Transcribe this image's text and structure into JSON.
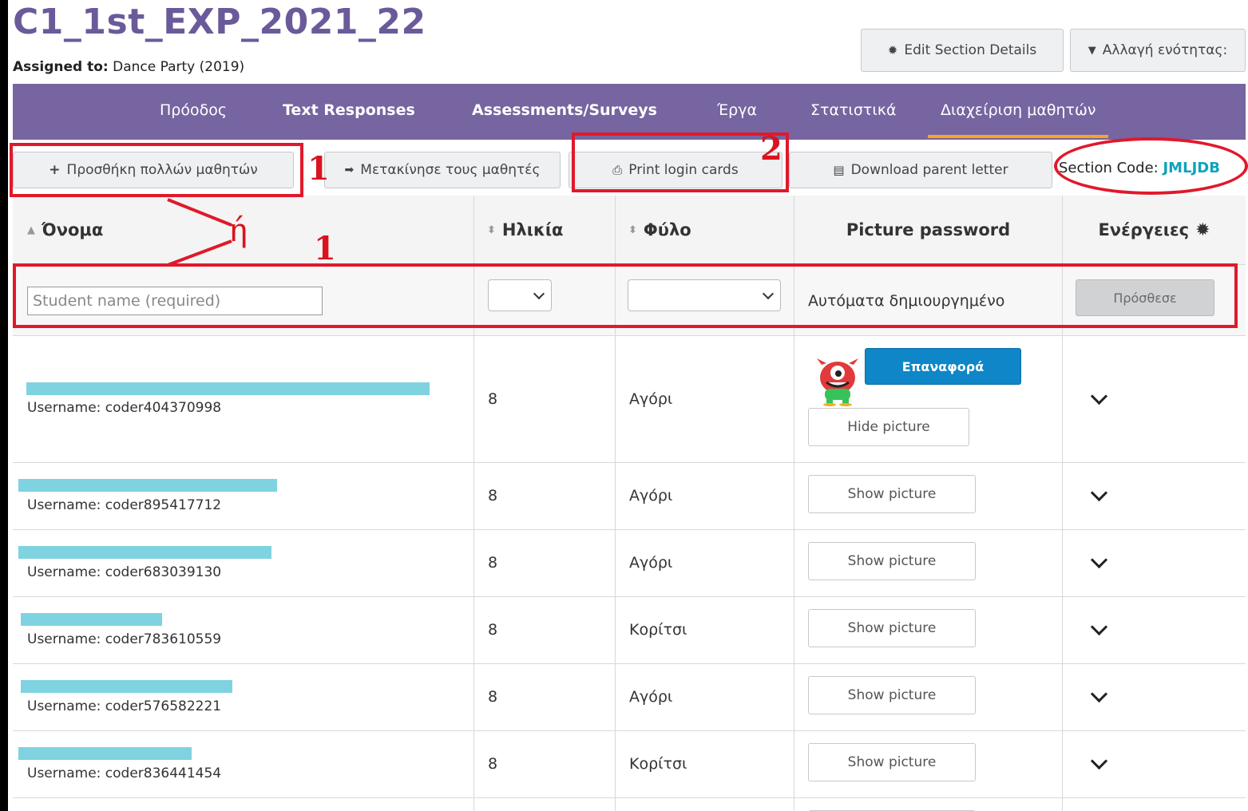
{
  "header": {
    "section_title": "C1_1st_EXP_2021_22",
    "assigned_label": "Assigned to:",
    "assigned_value": "Dance Party (2019)",
    "edit_section_label": "Edit Section Details",
    "change_section_label": "Αλλαγή ενότητας:"
  },
  "nav": {
    "tabs": [
      {
        "label": "Πρόοδος"
      },
      {
        "label": "Text Responses"
      },
      {
        "label": "Assessments/Surveys"
      },
      {
        "label": "Έργα"
      },
      {
        "label": "Στατιστικά"
      },
      {
        "label": "Διαχείριση μαθητών"
      }
    ],
    "active_tab": "Διαχείριση μαθητών"
  },
  "toolbar": {
    "add_many_label": "Προσθήκη πολλών μαθητών",
    "move_students_label": "Μετακίνησε τους μαθητές",
    "print_cards_label": "Print login cards",
    "parent_letter_label": "Download parent letter",
    "section_code_label": "Section Code:",
    "section_code_value": "JMLJDB"
  },
  "table": {
    "headers": {
      "name": "Όνομα",
      "age": "Ηλικία",
      "gender": "Φύλο",
      "picture": "Picture password",
      "actions": "Ενέργειες"
    },
    "add_row": {
      "name_placeholder": "Student name (required)",
      "auto_generated": "Αυτόματα δημιουργημένο",
      "add_button": "Πρόσθεσε"
    },
    "rows": [
      {
        "username": "Username: coder404370998",
        "age": "8",
        "gender": "Αγόρι",
        "reset_label": "Επαναφορά",
        "picture_button": "Hide picture"
      },
      {
        "username": "Username: coder895417712",
        "age": "8",
        "gender": "Αγόρι",
        "picture_button": "Show picture"
      },
      {
        "username": "Username: coder683039130",
        "age": "8",
        "gender": "Αγόρι",
        "picture_button": "Show picture"
      },
      {
        "username": "Username: coder783610559",
        "age": "8",
        "gender": "Κορίτσι",
        "picture_button": "Show picture"
      },
      {
        "username": "Username: coder576582221",
        "age": "8",
        "gender": "Αγόρι",
        "picture_button": "Show picture"
      },
      {
        "username": "Username: coder836441454",
        "age": "8",
        "gender": "Κορίτσι",
        "picture_button": "Show picture"
      }
    ]
  },
  "annotations": {
    "label_1": "1",
    "label_2": "2",
    "label_or": "ή"
  },
  "colors": {
    "nav_bg": "#7665a0",
    "title": "#6a5a9a",
    "active_underline": "#f5a623",
    "reset_button": "#0e86c7",
    "section_code": "#0fa3b8",
    "annotation_red": "#e0192a",
    "redaction": "#7fd3e0"
  },
  "icons": [
    "gear-icon",
    "caret-down-icon",
    "plus-icon",
    "move-icon",
    "printer-icon",
    "document-icon",
    "sort-icon",
    "chevron-down-icon",
    "monster-avatar-icon"
  ]
}
